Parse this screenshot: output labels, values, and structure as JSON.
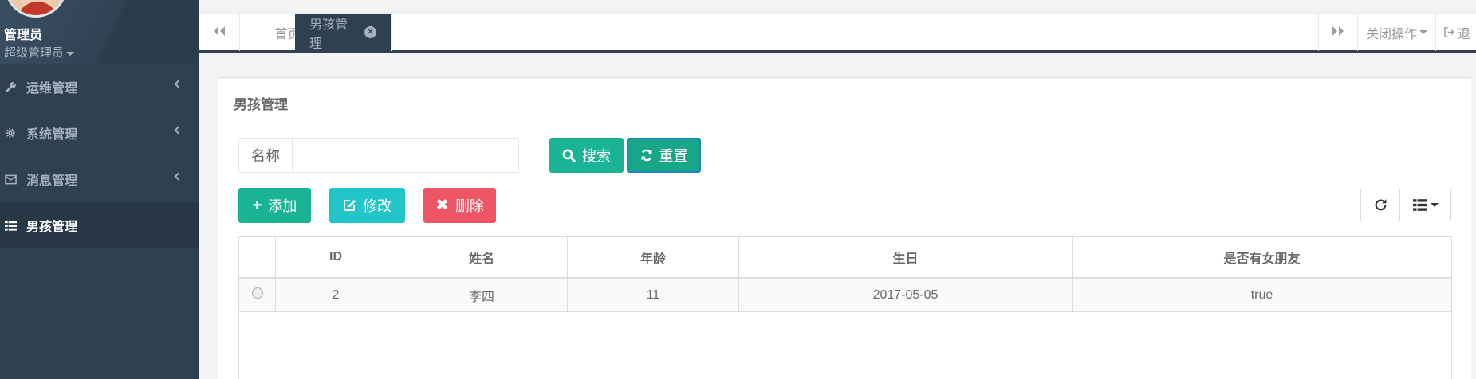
{
  "user": {
    "name": "管理员",
    "role": "超级管理员"
  },
  "sidebar": {
    "items": [
      {
        "label": "运维管理",
        "icon": "wrench-icon"
      },
      {
        "label": "系统管理",
        "icon": "gear-icon"
      },
      {
        "label": "消息管理",
        "icon": "envelope-icon"
      },
      {
        "label": "男孩管理",
        "icon": "list-icon",
        "active": true
      }
    ]
  },
  "tabs": {
    "items": [
      {
        "label": "首页"
      },
      {
        "label": "男孩管理",
        "active": true
      }
    ],
    "close_ops": "关闭操作",
    "logout": "退"
  },
  "panel": {
    "title": "男孩管理"
  },
  "search": {
    "label": "名称",
    "value": "",
    "placeholder": ""
  },
  "buttons": {
    "search": "搜索",
    "reset": "重置",
    "add": "添加",
    "edit": "修改",
    "delete": "删除"
  },
  "table": {
    "columns": [
      "",
      "ID",
      "姓名",
      "年龄",
      "生日",
      "是否有女朋友"
    ],
    "rows": [
      {
        "id": "2",
        "name": "李四",
        "age": "11",
        "birthday": "2017-05-05",
        "has_girlfriend": "true"
      }
    ]
  },
  "colors": {
    "sidebar": "#2f4050",
    "primary": "#1ab394",
    "info": "#23c6c8",
    "danger": "#ed5565"
  }
}
